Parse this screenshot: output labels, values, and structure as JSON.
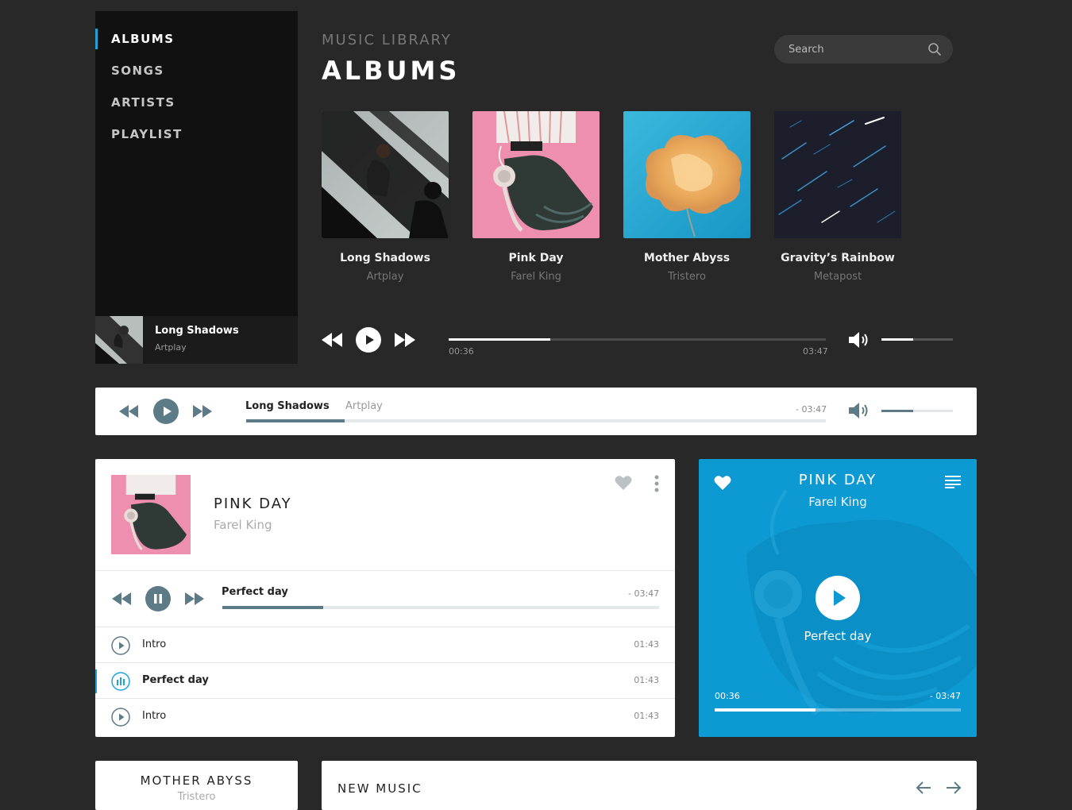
{
  "sidebar": {
    "items": [
      {
        "label": "ALBUMS",
        "active": true
      },
      {
        "label": "SONGS",
        "active": false
      },
      {
        "label": "ARTISTS",
        "active": false
      },
      {
        "label": "PLAYLIST",
        "active": false
      }
    ],
    "now_playing": {
      "title": "Long Shadows",
      "artist": "Artplay"
    }
  },
  "header": {
    "subtitle": "MUSIC LIBRARY",
    "title": "ALBUMS"
  },
  "search": {
    "placeholder": "Search"
  },
  "albums": [
    {
      "title": "Long Shadows",
      "artist": "Artplay"
    },
    {
      "title": "Pink Day",
      "artist": "Farel King"
    },
    {
      "title": "Mother Abyss",
      "artist": "Tristero"
    },
    {
      "title": "Gravity’s Rainbow",
      "artist": "Metapost"
    }
  ],
  "dark_player": {
    "elapsed": "00:36",
    "duration": "03:47",
    "progress": 0.27,
    "volume": 0.44
  },
  "light_player": {
    "title": "Long Shadows",
    "artist": "Artplay",
    "remaining": "- 03:47",
    "progress": 0.17,
    "volume": 0.44
  },
  "track_card": {
    "title": "PINK DAY",
    "artist": "Farel King",
    "current_track": "Perfect day",
    "remaining": "- 03:47",
    "progress": 0.23,
    "tracks": [
      {
        "title": "Intro",
        "time": "01:43",
        "playing": false
      },
      {
        "title": "Perfect day",
        "time": "01:43",
        "playing": true
      },
      {
        "title": "Intro",
        "time": "01:43",
        "playing": false
      }
    ]
  },
  "blue_card": {
    "title": "PINK DAY",
    "artist": "Farel King",
    "track": "Perfect day",
    "elapsed": "00:36",
    "remaining": "- 03:47",
    "progress": 0.41
  },
  "mini_card": {
    "title": "MOTHER ABYSS",
    "artist": "Tristero"
  },
  "new_music": {
    "title": "NEW MUSIC"
  },
  "colors": {
    "accent": "#1fa3d6",
    "blue_card": "#0d9ad3",
    "slate": "#5d7b87",
    "background": "#282828"
  }
}
